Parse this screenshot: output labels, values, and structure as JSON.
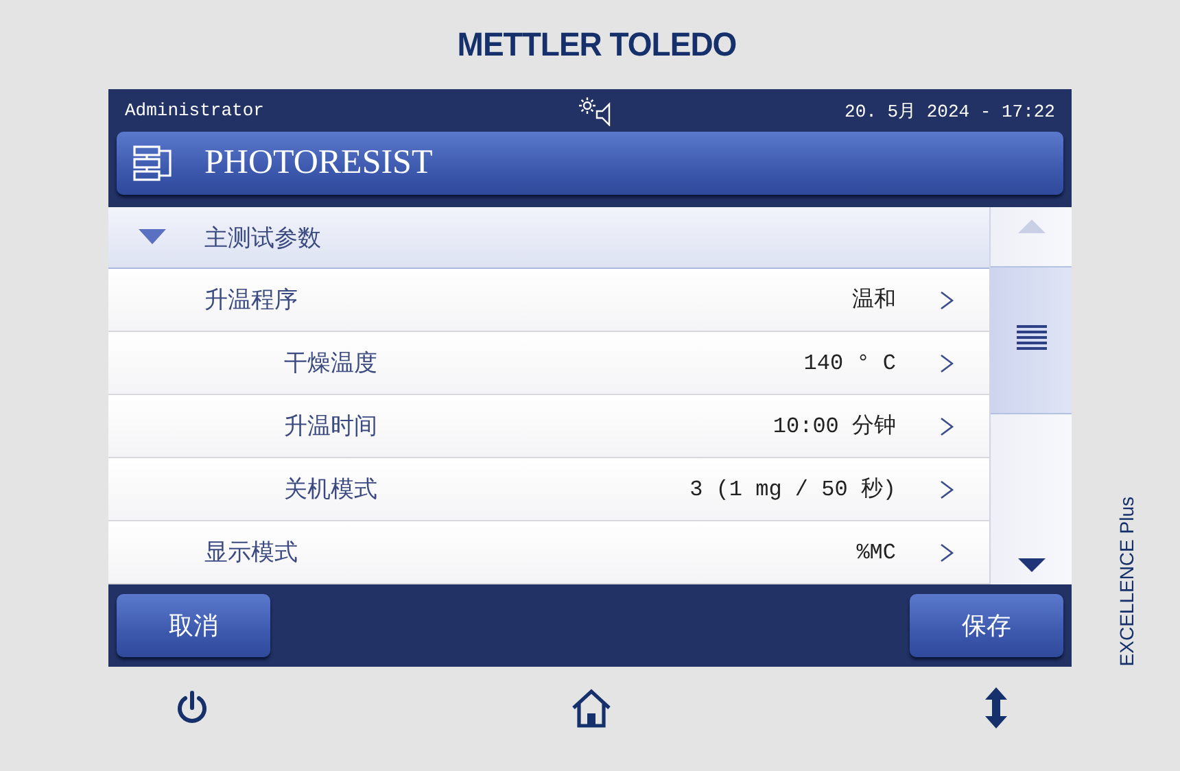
{
  "brand": "METTLER TOLEDO",
  "product": "EXCELLENCE Plus",
  "status_bar": {
    "user": "Administrator",
    "datetime": "20. 5月 2024 - 17:22"
  },
  "title": "PHOTORESIST",
  "section": {
    "label": "主测试参数",
    "expanded": true
  },
  "rows": [
    {
      "label": "升温程序",
      "value": "温和",
      "children": [
        {
          "label": "干燥温度",
          "value": "140 ° C"
        },
        {
          "label": "升温时间",
          "value": "10:00 分钟"
        },
        {
          "label": "关机模式",
          "value": "3 (1 mg / 50 秒)"
        }
      ]
    },
    {
      "label": "显示模式",
      "value": "%MC"
    }
  ],
  "buttons": {
    "cancel": "取消",
    "save": "保存"
  }
}
